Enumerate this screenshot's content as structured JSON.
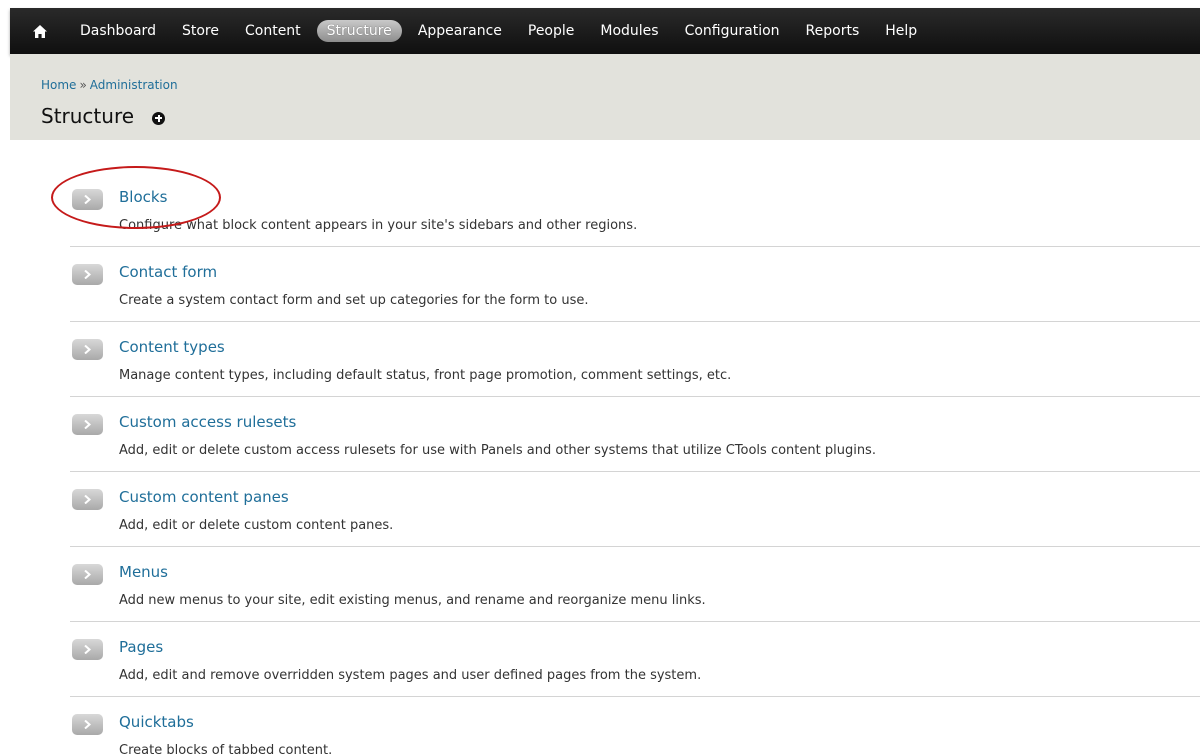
{
  "toolbar": {
    "home_icon": "home-icon",
    "items": [
      {
        "label": "Dashboard",
        "active": false
      },
      {
        "label": "Store",
        "active": false
      },
      {
        "label": "Content",
        "active": false
      },
      {
        "label": "Structure",
        "active": true
      },
      {
        "label": "Appearance",
        "active": false
      },
      {
        "label": "People",
        "active": false
      },
      {
        "label": "Modules",
        "active": false
      },
      {
        "label": "Configuration",
        "active": false
      },
      {
        "label": "Reports",
        "active": false
      },
      {
        "label": "Help",
        "active": false
      }
    ]
  },
  "breadcrumb": {
    "items": [
      "Home",
      "Administration"
    ],
    "separator": "»"
  },
  "page": {
    "title": "Structure",
    "shortcut_icon": "add-shortcut-icon"
  },
  "admin_list": {
    "items": [
      {
        "title": "Blocks",
        "description": "Configure what block content appears in your site's sidebars and other regions."
      },
      {
        "title": "Contact form",
        "description": "Create a system contact form and set up categories for the form to use."
      },
      {
        "title": "Content types",
        "description": "Manage content types, including default status, front page promotion, comment settings, etc."
      },
      {
        "title": "Custom access rulesets",
        "description": "Add, edit or delete custom access rulesets for use with Panels and other systems that utilize CTools content plugins."
      },
      {
        "title": "Custom content panes",
        "description": "Add, edit or delete custom content panes."
      },
      {
        "title": "Menus",
        "description": "Add new menus to your site, edit existing menus, and rename and reorganize menu links."
      },
      {
        "title": "Pages",
        "description": "Add, edit and remove overridden system pages and user defined pages from the system."
      },
      {
        "title": "Quicktabs",
        "description": "Create blocks of tabbed content."
      }
    ]
  },
  "colors": {
    "toolbar_bg": "#1a1a1a",
    "header_bg": "#e2e2dc",
    "link": "#1f6e99",
    "annotation_red": "#c51a1a"
  }
}
